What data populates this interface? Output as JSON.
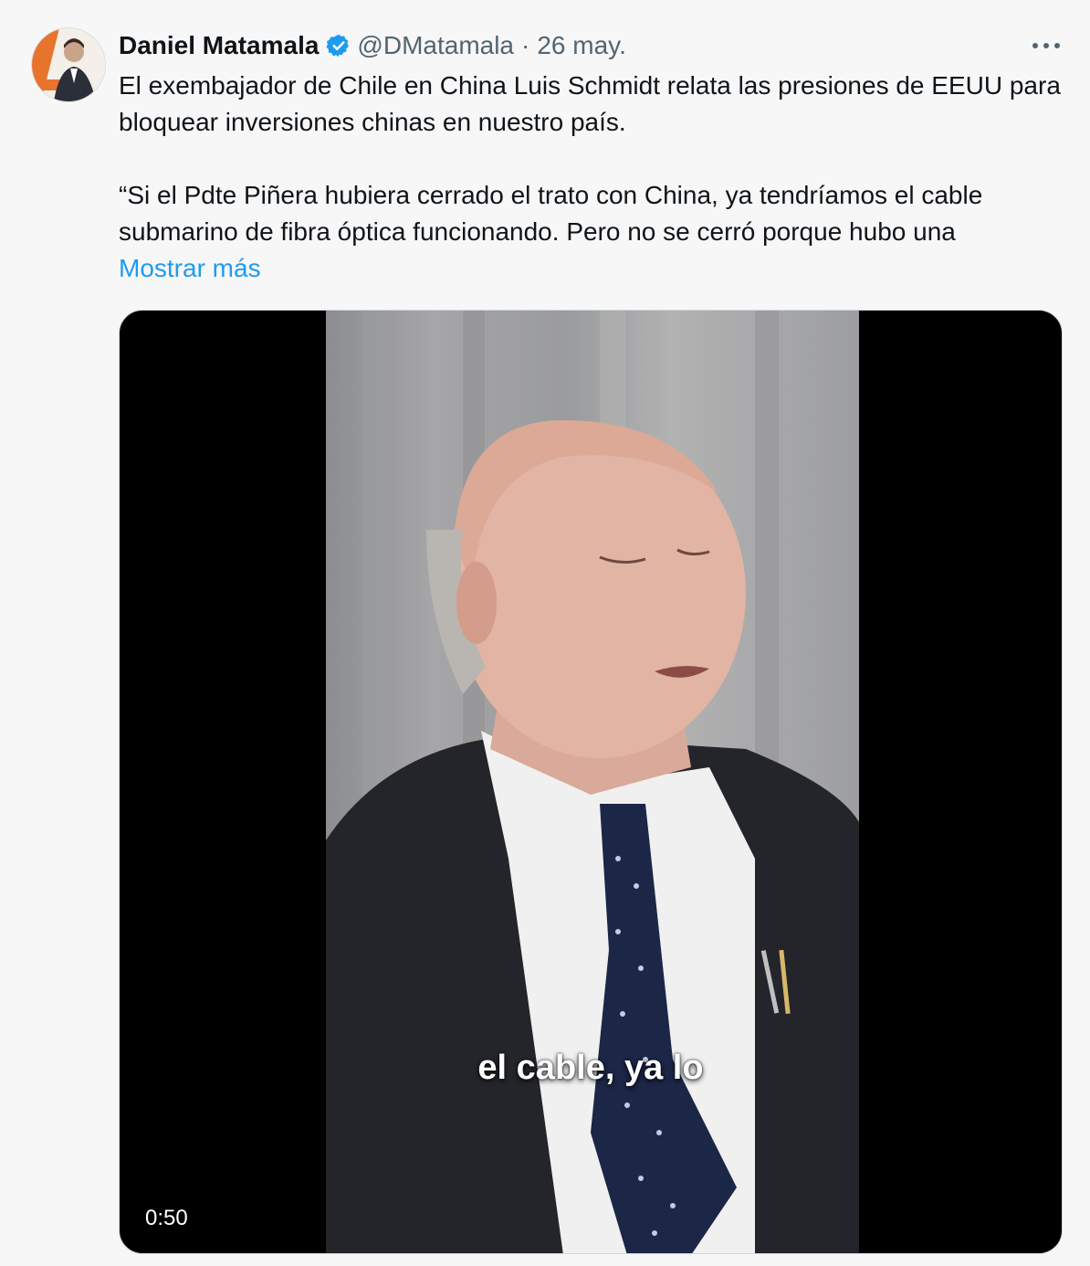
{
  "author": {
    "name": "Daniel Matamala",
    "handle": "@DMatamala",
    "separator": "·",
    "date": "26 may.",
    "verified": true,
    "avatar_icon": "avatar-icon"
  },
  "tweet": {
    "paragraph_1": "El exembajador de Chile en China Luis Schmidt relata las presiones de EEUU para bloquear inversiones chinas en nuestro país.",
    "paragraph_2": "“Si el Pdte Piñera hubiera cerrado el trato con China, ya tendríamos el cable submarino de fibra óptica funcionando. Pero no se cerró porque hubo una",
    "show_more": "Mostrar más"
  },
  "video": {
    "subtitle": "el cable, ya lo",
    "duration": "0:50"
  },
  "colors": {
    "link": "#1d9bf0",
    "verified": "#1d9bf0",
    "secondary_text": "#536471"
  }
}
